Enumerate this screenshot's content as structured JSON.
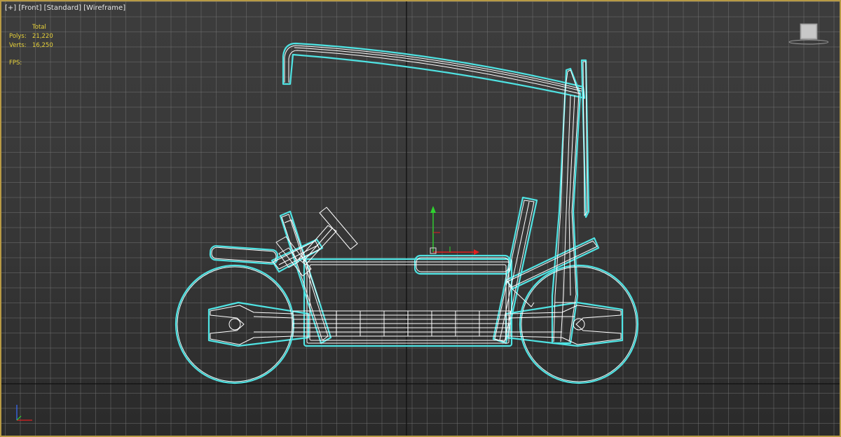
{
  "viewport": {
    "label_plus": "[+]",
    "label_view": "[Front]",
    "label_shading": "[Standard]",
    "label_mode": "[Wireframe]"
  },
  "stats": {
    "header": "Total",
    "polys_label": "Polys:",
    "polys_value": "21,220",
    "verts_label": "Verts:",
    "verts_value": "16,250",
    "fps_label": "FPS:"
  },
  "colors": {
    "frame_border": "#b89a45",
    "selection_outline": "#4fe3e3",
    "wire": "#ffffff",
    "stats_text": "#e9d33a",
    "gizmo_y": "#2fd22f",
    "gizmo_x": "#e02020"
  },
  "icons": {
    "viewcube": "viewcube-icon",
    "transform_gizmo": "move-gizmo-icon",
    "axis_tripod": "axis-tripod-icon"
  }
}
